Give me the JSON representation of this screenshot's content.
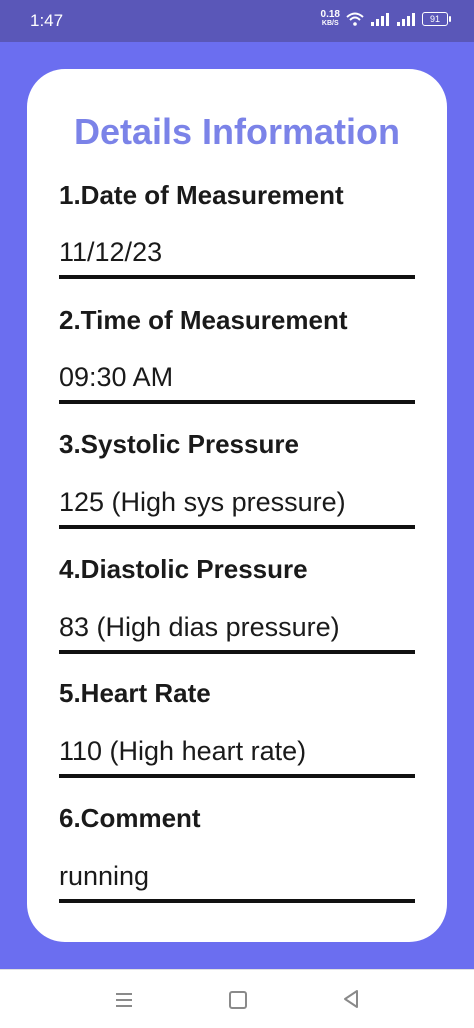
{
  "status": {
    "time": "1:47",
    "netspeed_value": "0.18",
    "netspeed_unit": "KB/S",
    "battery": "91"
  },
  "page": {
    "title": "Details Information",
    "fields": [
      {
        "label": "1.Date of Measurement",
        "value": "11/12/23"
      },
      {
        "label": "2.Time of Measurement",
        "value": "09:30 AM"
      },
      {
        "label": "3.Systolic Pressure",
        "value": "125 (High sys pressure)"
      },
      {
        "label": "4.Diastolic Pressure",
        "value": "83 (High dias pressure)"
      },
      {
        "label": "5.Heart Rate",
        "value": "110 (High heart rate)"
      },
      {
        "label": "6.Comment",
        "value": "running"
      }
    ]
  },
  "colors": {
    "status_bar": "#5a57b8",
    "background": "#6b6ef0",
    "title": "#7b83e8"
  },
  "icons": {
    "wifi": "wifi-icon",
    "signal": "signal-icon",
    "battery": "battery-icon",
    "nav_recent": "menu-icon",
    "nav_home": "home-icon",
    "nav_back": "back-icon"
  }
}
